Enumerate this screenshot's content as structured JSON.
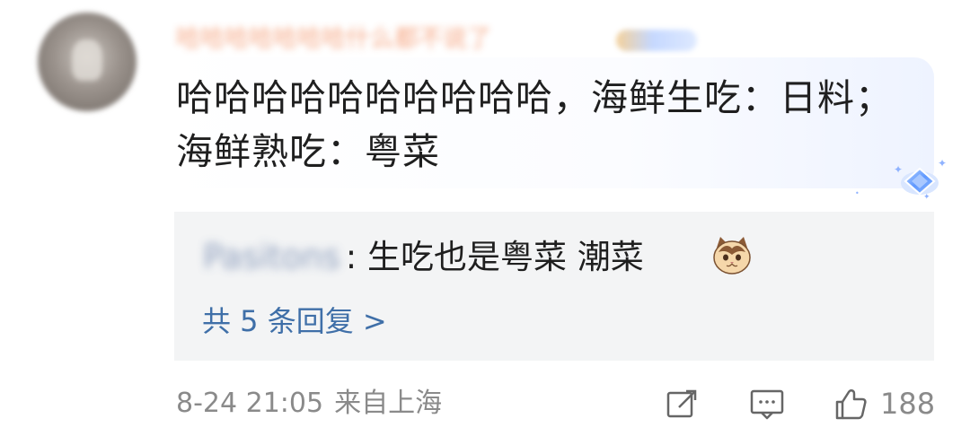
{
  "comment": {
    "author_name": "哈哈哈哈哈哈哈什么都不说了",
    "text": "哈哈哈哈哈哈哈哈哈哈，海鲜生吃：日料；海鲜熟吃：粤菜",
    "timestamp": "8-24 21:05",
    "location": "来自上海",
    "like_count": "188"
  },
  "reply": {
    "author_name": "Pasitons",
    "text": ": 生吃也是粤菜 潮菜",
    "more_label": "共 5 条回复 >"
  },
  "icons": {
    "avatar": "user-avatar",
    "badge": "member-badge",
    "decoration": "diamond-gem-icon",
    "emoji": "cat-emoji",
    "share": "share-icon",
    "comment": "comment-icon",
    "like": "like-icon"
  },
  "colors": {
    "text": "#1f1f1f",
    "link": "#3f6fa8",
    "meta": "#8a8a8a",
    "reply_background": "#f3f4f5",
    "username": "#f5a07a"
  }
}
